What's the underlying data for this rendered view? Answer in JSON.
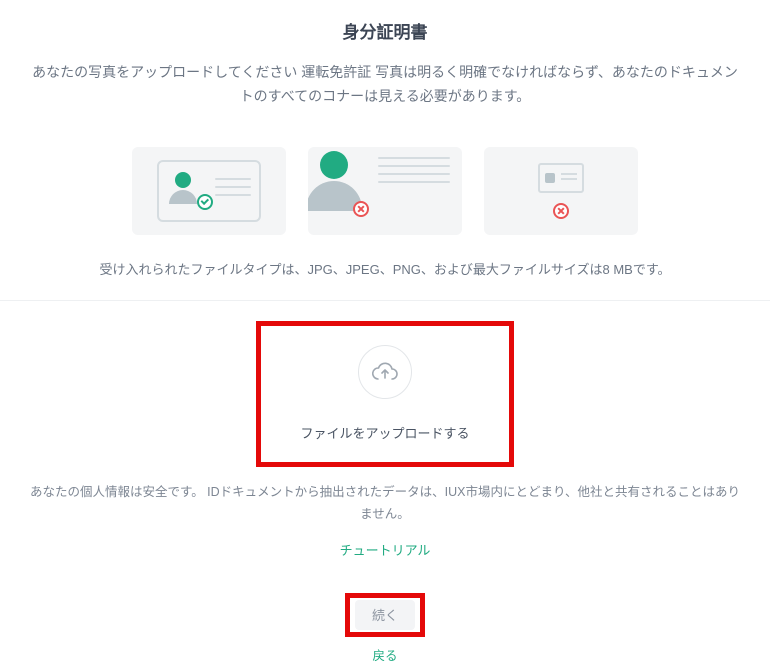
{
  "header": {
    "title": "身分証明書",
    "instructions": "あなたの写真をアップロードしてください 運転免許証 写真は明るく明確でなければならず、あなたのドキュメントのすべてのコナーは見える必要があります。"
  },
  "examples": {
    "items": [
      {
        "status": "ok"
      },
      {
        "status": "bad"
      },
      {
        "status": "bad"
      }
    ],
    "file_info": "受け入れられたファイルタイプは、JPG、JPEG、PNG、および最大ファイルサイズは8 MBです。"
  },
  "upload": {
    "label": "ファイルをアップロードする"
  },
  "privacy": "あなたの個人情報は安全です。 IDドキュメントから抽出されたデータは、IUX市場内にとどまり、他社と共有されることはありません。",
  "links": {
    "tutorial": "チュートリアル",
    "back": "戻る"
  },
  "buttons": {
    "continue": "続く"
  }
}
